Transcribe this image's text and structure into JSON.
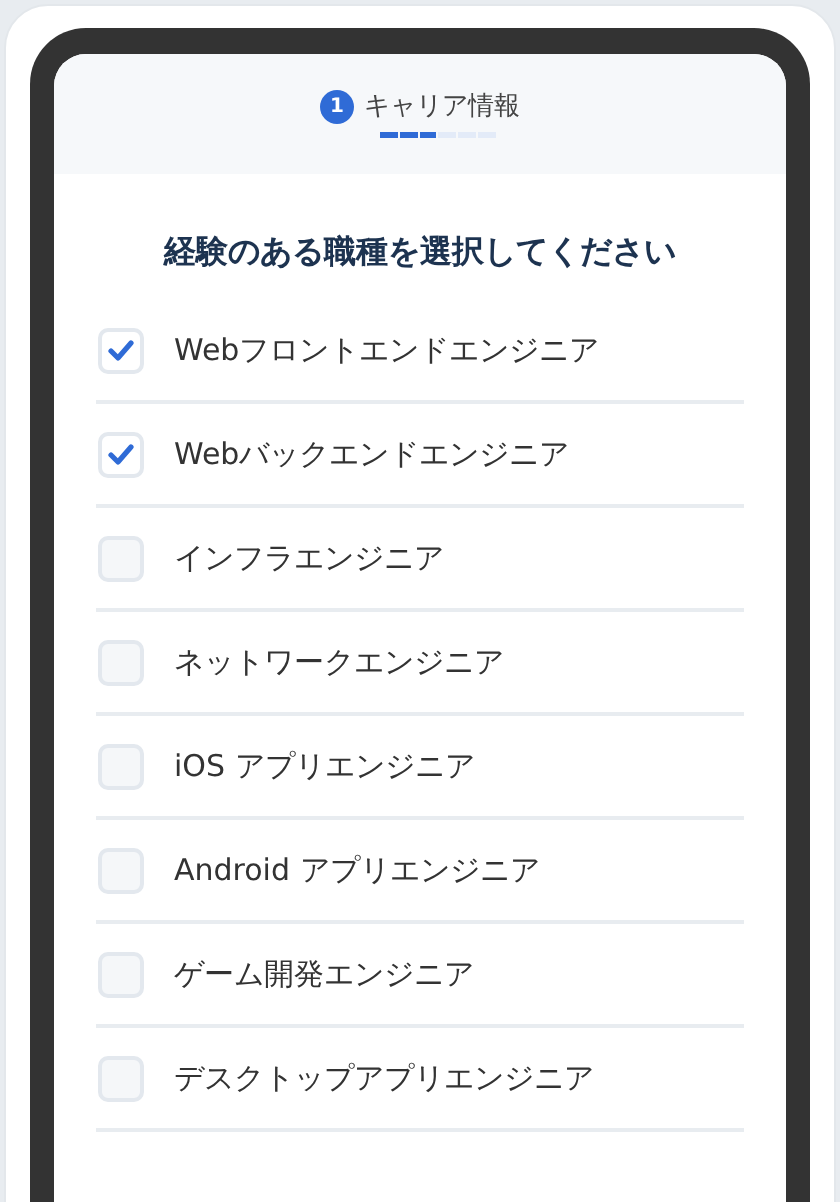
{
  "header": {
    "step_number": "1",
    "step_title": "キャリア情報",
    "progress": {
      "level": 0.5
    }
  },
  "question": "経験のある職種を選択してください",
  "options": [
    {
      "label": "Webフロントエンドエンジニア",
      "checked": true
    },
    {
      "label": "Webバックエンドエンジニア",
      "checked": true
    },
    {
      "label": "インフラエンジニア",
      "checked": false
    },
    {
      "label": "ネットワークエンジニア",
      "checked": false
    },
    {
      "label": "iOS アプリエンジニア",
      "checked": false
    },
    {
      "label": "Android アプリエンジニア",
      "checked": false
    },
    {
      "label": "ゲーム開発エンジニア",
      "checked": false
    },
    {
      "label": "デスクトップアプリエンジニア",
      "checked": false
    }
  ]
}
